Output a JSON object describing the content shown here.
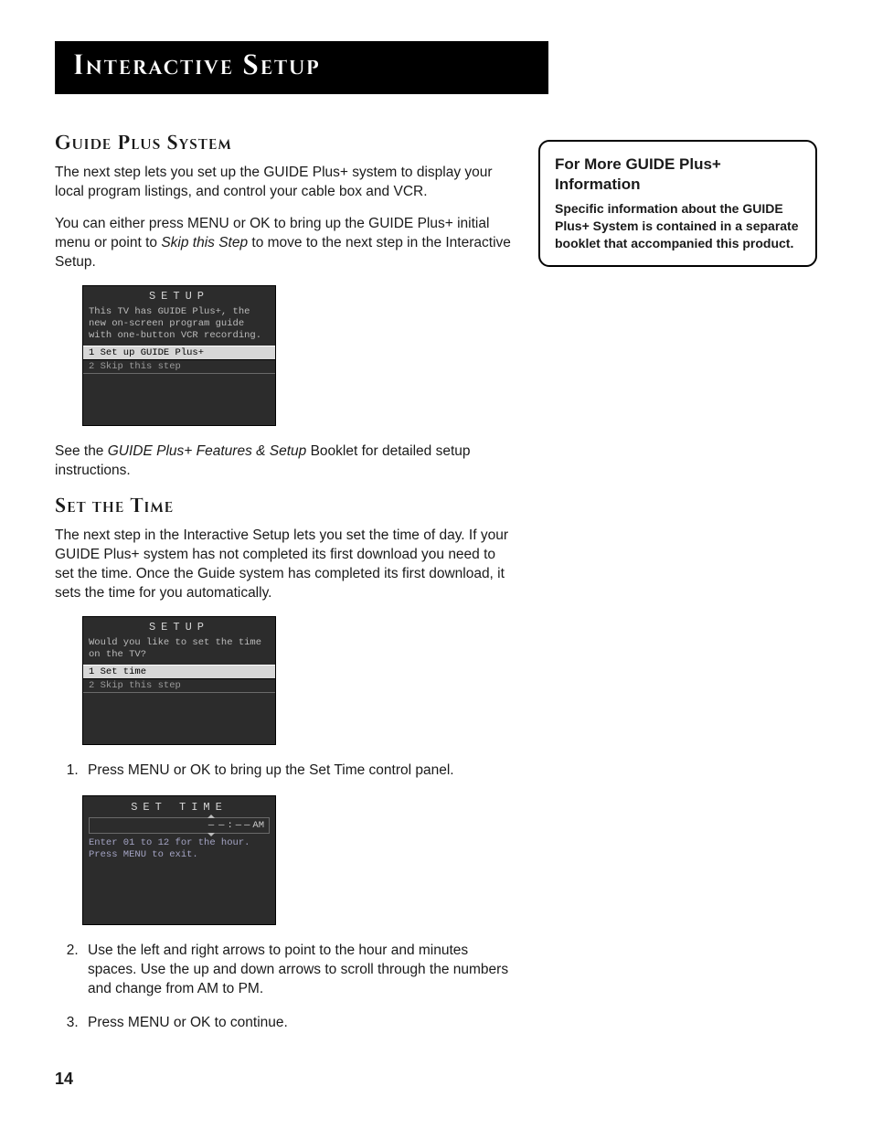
{
  "header": "Interactive Setup",
  "guideplus": {
    "title": "Guide Plus  System",
    "para1": "The next step lets you set up the GUIDE Plus+ system to display your local program listings, and control your cable box and VCR.",
    "para2_a": "You can either press MENU or OK to bring up the GUIDE Plus+ initial menu or point to ",
    "para2_em": "Skip this Step",
    "para2_b": " to move to the next step in the Interactive Setup.",
    "panel": {
      "title": "SETUP",
      "desc": "This TV has GUIDE Plus+, the new on-screen program guide with one-button VCR recording.",
      "opt1": "1 Set up GUIDE Plus+",
      "opt2": "2 Skip this step"
    },
    "after_a": "See the ",
    "after_em": "GUIDE Plus+ Features & Setup",
    "after_b": " Booklet for detailed setup instructions."
  },
  "settime": {
    "title": "Set the Time",
    "para1": "The next step in the Interactive Setup lets you set the time of day. If your GUIDE Plus+ system has not completed its first download you need to set the time. Once the Guide system has completed its first download, it sets the time for you automatically.",
    "panel": {
      "title": "SETUP",
      "desc": "Would you like to set the time on the TV?",
      "opt1": "1 Set time",
      "opt2": "2 Skip this step"
    },
    "step1": "Press MENU or OK to bring up the Set Time control panel.",
    "st_panel": {
      "title": "SET TIME",
      "slot1": "—",
      "slot2": "—",
      "colon": ":",
      "slot3": "—",
      "slot4": "—",
      "ampm": "AM",
      "line1": "Enter 01 to 12 for the hour.",
      "line2": "Press MENU to exit."
    },
    "step2": "Use the left and right arrows to point to the hour and minutes spaces. Use the up and down arrows to scroll through the numbers and change from AM to PM.",
    "step3": "Press  MENU or OK to continue."
  },
  "sidebar": {
    "title": "For More GUIDE Plus+ Information",
    "text": "Specific information about the GUIDE Plus+ System is contained in a separate booklet that accompanied this product."
  },
  "page_number": "14"
}
